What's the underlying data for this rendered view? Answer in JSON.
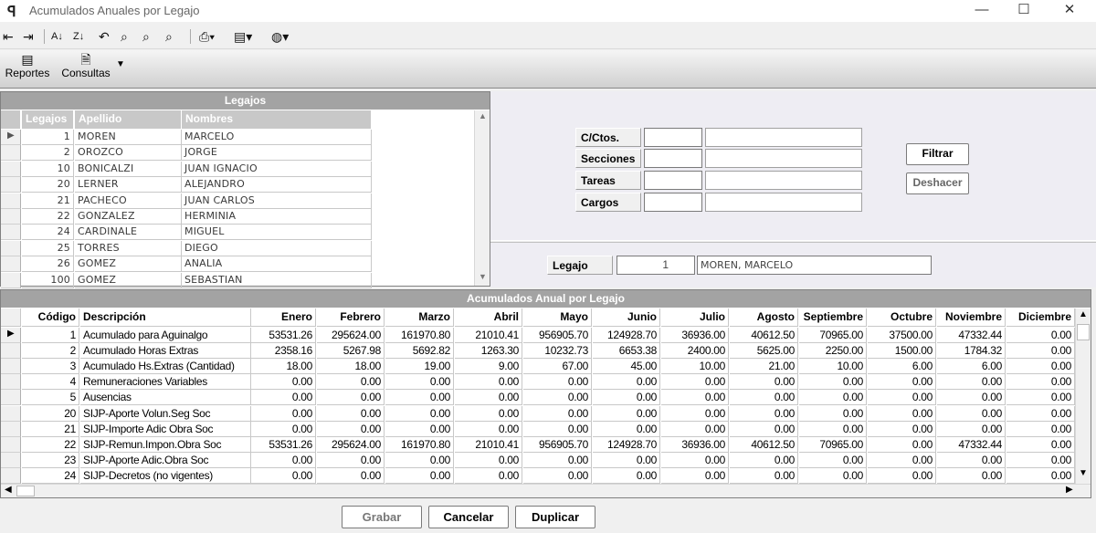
{
  "window": {
    "title": "Acumulados Anuales por Legajo",
    "minimize": "—",
    "maximize": "☐",
    "close": "✕"
  },
  "toolbar": {
    "icons": [
      "indent-left-icon",
      "indent-right-icon",
      "sort-az-icon",
      "sort-za-icon",
      "undo-icon",
      "find-icon",
      "find-next-icon",
      "find-prev-icon",
      "print-icon",
      "export-icon",
      "web-icon"
    ]
  },
  "ribbon": {
    "reportes": "Reportes",
    "consultas": "Consultas"
  },
  "legajos": {
    "title": "Legajos",
    "headers": [
      "Legajos",
      "Apellido",
      "Nombres"
    ],
    "rows": [
      [
        "1",
        "MOREN",
        "MARCELO"
      ],
      [
        "2",
        "OROZCO",
        "JORGE"
      ],
      [
        "10",
        "BONICALZI",
        "JUAN IGNACIO"
      ],
      [
        "20",
        "LERNER",
        "ALEJANDRO"
      ],
      [
        "21",
        "PACHECO",
        "JUAN CARLOS"
      ],
      [
        "22",
        "GONZALEZ",
        "HERMINIA"
      ],
      [
        "24",
        "CARDINALE",
        "MIGUEL"
      ],
      [
        "25",
        "TORRES",
        "DIEGO"
      ],
      [
        "26",
        "GOMEZ",
        "ANALIA"
      ],
      [
        "100",
        "GOMEZ",
        "SEBASTIAN"
      ]
    ]
  },
  "filters": {
    "labels": [
      "C/Ctos.",
      "Secciones",
      "Tareas",
      "Cargos"
    ],
    "filtrar": "Filtrar",
    "deshacer": "Deshacer"
  },
  "legajo_sel": {
    "label": "Legajo",
    "number": "1",
    "name": "MOREN, MARCELO"
  },
  "acumulados": {
    "title": "Acumulados Anual por Legajo",
    "headers": [
      "Código",
      "Descripción",
      "Enero",
      "Febrero",
      "Marzo",
      "Abril",
      "Mayo",
      "Junio",
      "Julio",
      "Agosto",
      "Septiembre",
      "Octubre",
      "Noviembre",
      "Diciembre"
    ],
    "rows": [
      [
        "1",
        "Acumulado para Aguinalgo",
        "53531.26",
        "295624.00",
        "161970.80",
        "21010.41",
        "956905.70",
        "124928.70",
        "36936.00",
        "40612.50",
        "70965.00",
        "37500.00",
        "47332.44",
        "0.00"
      ],
      [
        "2",
        "Acumulado Horas Extras",
        "2358.16",
        "5267.98",
        "5692.82",
        "1263.30",
        "10232.73",
        "6653.38",
        "2400.00",
        "5625.00",
        "2250.00",
        "1500.00",
        "1784.32",
        "0.00"
      ],
      [
        "3",
        "Acumulado Hs.Extras (Cantidad)",
        "18.00",
        "18.00",
        "19.00",
        "9.00",
        "67.00",
        "45.00",
        "10.00",
        "21.00",
        "10.00",
        "6.00",
        "6.00",
        "0.00"
      ],
      [
        "4",
        "Remuneraciones Variables",
        "0.00",
        "0.00",
        "0.00",
        "0.00",
        "0.00",
        "0.00",
        "0.00",
        "0.00",
        "0.00",
        "0.00",
        "0.00",
        "0.00"
      ],
      [
        "5",
        "Ausencias",
        "0.00",
        "0.00",
        "0.00",
        "0.00",
        "0.00",
        "0.00",
        "0.00",
        "0.00",
        "0.00",
        "0.00",
        "0.00",
        "0.00"
      ],
      [
        "20",
        "SIJP-Aporte Volun.Seg Soc",
        "0.00",
        "0.00",
        "0.00",
        "0.00",
        "0.00",
        "0.00",
        "0.00",
        "0.00",
        "0.00",
        "0.00",
        "0.00",
        "0.00"
      ],
      [
        "21",
        "SIJP-Importe Adic Obra Soc",
        "0.00",
        "0.00",
        "0.00",
        "0.00",
        "0.00",
        "0.00",
        "0.00",
        "0.00",
        "0.00",
        "0.00",
        "0.00",
        "0.00"
      ],
      [
        "22",
        "SIJP-Remun.Impon.Obra Soc",
        "53531.26",
        "295624.00",
        "161970.80",
        "21010.41",
        "956905.70",
        "124928.70",
        "36936.00",
        "40612.50",
        "70965.00",
        "0.00",
        "47332.44",
        "0.00"
      ],
      [
        "23",
        "SIJP-Aporte Adic.Obra Soc",
        "0.00",
        "0.00",
        "0.00",
        "0.00",
        "0.00",
        "0.00",
        "0.00",
        "0.00",
        "0.00",
        "0.00",
        "0.00",
        "0.00"
      ],
      [
        "24",
        "SIJP-Decretos (no vigentes)",
        "0.00",
        "0.00",
        "0.00",
        "0.00",
        "0.00",
        "0.00",
        "0.00",
        "0.00",
        "0.00",
        "0.00",
        "0.00",
        "0.00"
      ]
    ]
  },
  "buttons": {
    "grabar": "Grabar",
    "cancelar": "Cancelar",
    "duplicar": "Duplicar"
  }
}
